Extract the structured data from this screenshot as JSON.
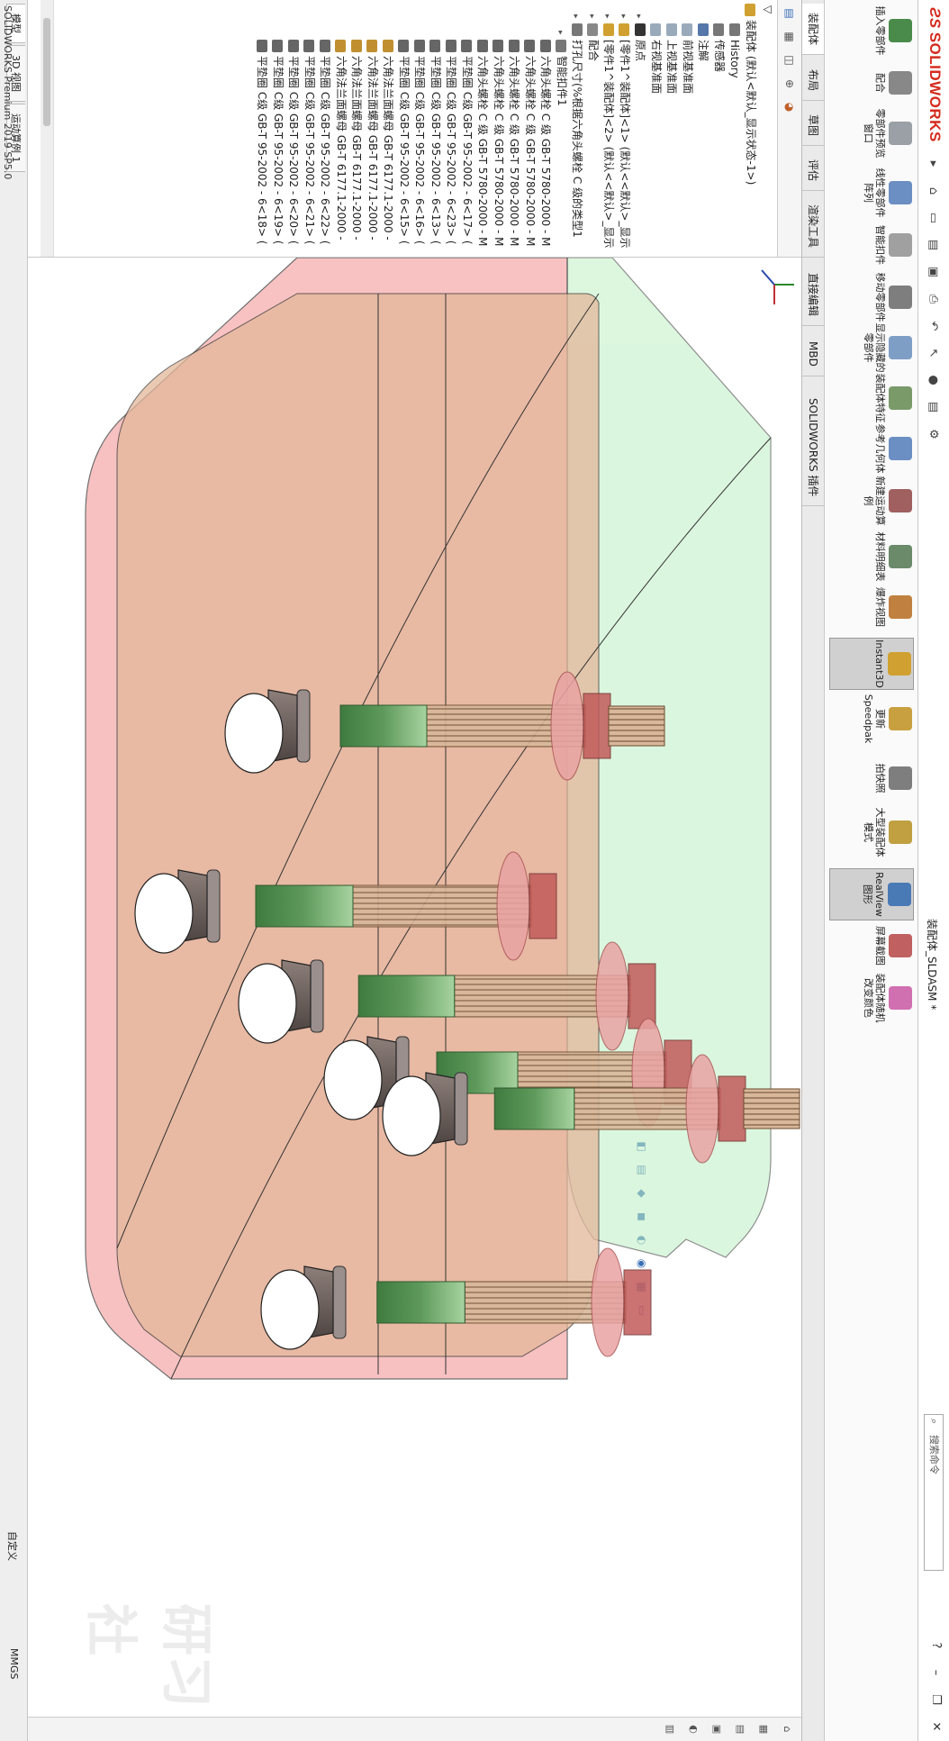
{
  "app": {
    "brand": "SOLIDWORKS",
    "document_title": "装配体_SLDASM *",
    "search_placeholder": "搜索命令",
    "version": "SOLIDWORKS Premium 2019 SP5.0"
  },
  "ribbon": {
    "buttons": [
      {
        "label": "插入零部件",
        "icon": "insert-component-icon",
        "color": "#4a8a4a"
      },
      {
        "label": "配合",
        "icon": "mate-icon",
        "color": "#888888"
      },
      {
        "label": "零部件预览窗口",
        "icon": "component-preview-icon",
        "color": "#9aa0a6"
      },
      {
        "label": "线性零部件阵列",
        "icon": "linear-pattern-icon",
        "color": "#6b8fc2"
      },
      {
        "label": "智能扣件",
        "icon": "smart-fastener-icon",
        "color": "#a0a0a0"
      },
      {
        "label": "移动零部件",
        "icon": "move-component-icon",
        "color": "#7e7e7e"
      },
      {
        "label": "显示隐藏的零部件",
        "icon": "show-hidden-icon",
        "color": "#7e9ec6"
      },
      {
        "label": "装配体特征",
        "icon": "assembly-feature-icon",
        "color": "#7a9a6a"
      },
      {
        "label": "参考几何体",
        "icon": "reference-geometry-icon",
        "color": "#6b8fc2"
      },
      {
        "label": "新建运动算例",
        "icon": "motion-study-icon",
        "color": "#a06060"
      },
      {
        "label": "材料明细表",
        "icon": "bom-icon",
        "color": "#6a8a6a"
      },
      {
        "label": "爆炸视图",
        "icon": "exploded-view-icon",
        "color": "#c08040"
      },
      {
        "label": "Instant3D",
        "icon": "instant3d-icon",
        "color": "#d0a030"
      },
      {
        "label": "更新Speedpak",
        "icon": "speedpak-icon",
        "color": "#c8a040"
      },
      {
        "label": "拍快照",
        "icon": "snapshot-icon",
        "color": "#7e7e7e"
      },
      {
        "label": "大型装配体模式",
        "icon": "large-assembly-icon",
        "color": "#c0a040"
      },
      {
        "label": "RealView图形",
        "icon": "realview-icon",
        "color": "#4a7ab5"
      },
      {
        "label": "屏幕截图",
        "icon": "screen-capture-icon",
        "color": "#c06060"
      },
      {
        "label": "装配体随机改变颜色",
        "icon": "random-color-icon",
        "color": "#d070b0"
      }
    ]
  },
  "tabs": [
    {
      "label": "装配体"
    },
    {
      "label": "布局"
    },
    {
      "label": "草图"
    },
    {
      "label": "评估"
    },
    {
      "label": "渲染工具"
    },
    {
      "label": "直接编辑"
    },
    {
      "label": "MBD"
    },
    {
      "label": "SOLIDWORKS 插件"
    }
  ],
  "tree": {
    "root": "装配体 (默认<默认_显示状态-1>)",
    "nodes": [
      {
        "label": "History",
        "icon": "history-icon",
        "color": "#777777"
      },
      {
        "label": "传感器",
        "icon": "sensor-icon",
        "color": "#777777"
      },
      {
        "label": "注解",
        "icon": "annotation-icon",
        "color": "#5577aa"
      },
      {
        "label": "前视基准面",
        "icon": "plane-icon",
        "color": "#99aabb"
      },
      {
        "label": "上视基准面",
        "icon": "plane-icon",
        "color": "#99aabb"
      },
      {
        "label": "右视基准面",
        "icon": "plane-icon",
        "color": "#99aabb"
      },
      {
        "label": "原点",
        "icon": "origin-icon",
        "color": "#333333"
      },
      {
        "label": "[零件1^装配体]<1> (默认<<默认>_显示",
        "icon": "part-icon",
        "color": "#d0a030"
      },
      {
        "label": "[零件1^装配体]<2> (默认<<默认>_显示",
        "icon": "part-icon",
        "color": "#d0a030"
      },
      {
        "label": "配合",
        "icon": "mates-folder-icon",
        "color": "#888888"
      },
      {
        "label": "打孔尺寸(%根据六角头螺栓 C 级的类型1",
        "icon": "hole-icon",
        "color": "#777777"
      },
      {
        "label": "智能扣件1",
        "icon": "smart-fastener-icon",
        "color": "#777777"
      },
      {
        "label": "六角头螺栓 C 级 GB-T 5780-2000 - M",
        "icon": "bolt-icon",
        "color": "#666666"
      },
      {
        "label": "六角头螺栓 C 级 GB-T 5780-2000 - M",
        "icon": "bolt-icon",
        "color": "#666666"
      },
      {
        "label": "六角头螺栓 C 级 GB-T 5780-2000 - M",
        "icon": "bolt-icon",
        "color": "#666666"
      },
      {
        "label": "六角头螺栓 C 级 GB-T 5780-2000 - M",
        "icon": "bolt-icon",
        "color": "#666666"
      },
      {
        "label": "六角头螺栓 C 级 GB-T 5780-2000 - M",
        "icon": "bolt-icon",
        "color": "#666666"
      },
      {
        "label": "平垫圈 C级 GB-T 95-2002 - 6<17> (",
        "icon": "washer-icon",
        "color": "#666666"
      },
      {
        "label": "平垫圈 C级 GB-T 95-2002 - 6<23> (",
        "icon": "washer-icon",
        "color": "#666666"
      },
      {
        "label": "平垫圈 C级 GB-T 95-2002 - 6<13> (",
        "icon": "washer-icon",
        "color": "#666666"
      },
      {
        "label": "平垫圈 C级 GB-T 95-2002 - 6<16> (",
        "icon": "washer-icon",
        "color": "#666666"
      },
      {
        "label": "平垫圈 C级 GB-T 95-2002 - 6<15> (",
        "icon": "washer-icon",
        "color": "#666666"
      },
      {
        "label": "六角法兰面螺母 GB-T 6177.1-2000 -",
        "icon": "nut-icon",
        "color": "#c09030"
      },
      {
        "label": "六角法兰面螺母 GB-T 6177.1-2000 -",
        "icon": "nut-icon",
        "color": "#c09030"
      },
      {
        "label": "六角法兰面螺母 GB-T 6177.1-2000 -",
        "icon": "nut-icon",
        "color": "#c09030"
      },
      {
        "label": "六角法兰面螺母 GB-T 6177.1-2000 -",
        "icon": "nut-icon",
        "color": "#c09030"
      },
      {
        "label": "平垫圈 C级 GB-T 95-2002 - 6<22> (",
        "icon": "washer-icon",
        "color": "#666666"
      },
      {
        "label": "平垫圈 C级 GB-T 95-2002 - 6<21> (",
        "icon": "washer-icon",
        "color": "#666666"
      },
      {
        "label": "平垫圈 C级 GB-T 95-2002 - 6<20> (",
        "icon": "washer-icon",
        "color": "#666666"
      },
      {
        "label": "平垫圈 C级 GB-T 95-2002 - 6<19> (",
        "icon": "washer-icon",
        "color": "#666666"
      },
      {
        "label": "平垫圈 C级 GB-T 95-2002 - 6<18> (",
        "icon": "washer-icon",
        "color": "#666666"
      }
    ]
  },
  "statusbar": {
    "tabs": [
      "模型",
      "3D 视图",
      "运动算例 1"
    ],
    "unit_system": "自定义",
    "units": "MMGS"
  },
  "watermark": "研习社",
  "colors": {
    "plate_pink": "#f5a8a8",
    "plate_green": "#bff0c4",
    "bolt_thread": "#cfa98a",
    "bolt_shank": "#7ab07a",
    "brand_red": "#d52b1e"
  }
}
